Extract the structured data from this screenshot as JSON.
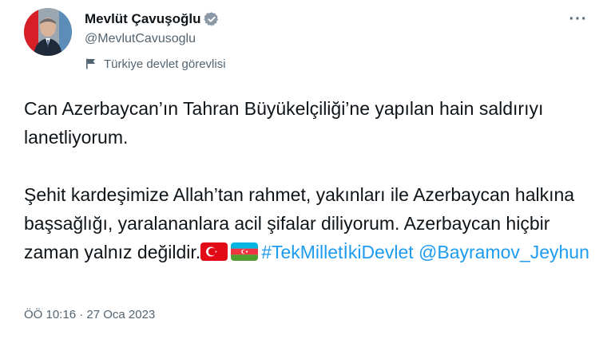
{
  "author": {
    "display_name": "Mevlüt Çavuşoğlu",
    "handle": "@MevlutCavusoglu",
    "affiliation": "Türkiye devlet görevlisi"
  },
  "icons": {
    "verified": "verified-badge-icon",
    "affiliation": "flag-icon",
    "more": "more-options-icon"
  },
  "colors": {
    "link": "#1d9bf0",
    "secondary_text": "#536471",
    "primary_text": "#0f1419",
    "verified": "#8b98a5"
  },
  "tweet": {
    "para1": "Can Azerbaycan’ın Tahran Büyükelçiliği’ne yapılan hain saldırıyı lanetliyorum.",
    "para2_text": "Şehit kardeşimize Allah’tan rahmet, yakınları ile Azerbaycan halkına başsağlığı, yaralananlara acil şifalar diliyorum. Azerbaycan hiçbir zaman yalnız değildir.",
    "emoji_flags": [
      "turkey-flag",
      "azerbaijan-flag"
    ],
    "hashtag": "#TekMilletİkiDevlet",
    "mention": "@Bayramov_Jeyhun"
  },
  "more_label": "···",
  "timestamp": "ÖÖ 10:16 · 27 Oca 2023"
}
